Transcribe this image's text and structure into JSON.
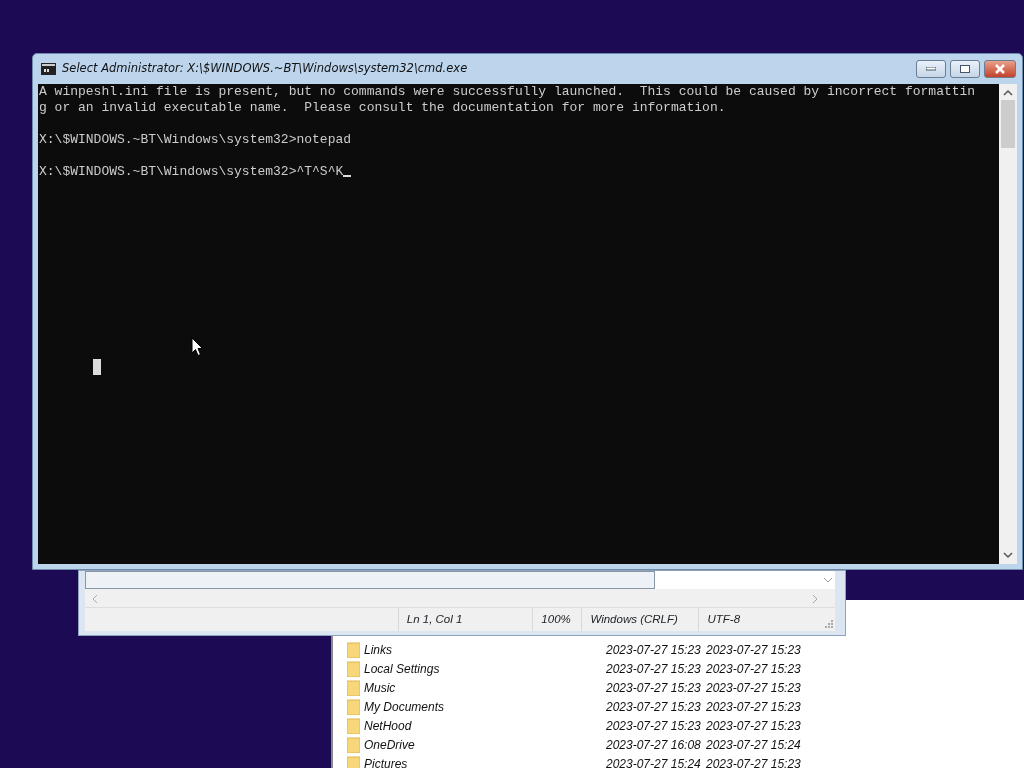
{
  "console_window": {
    "title": "Select Administrator: X:\\$WINDOWS.~BT\\Windows\\system32\\cmd.exe",
    "groups": [
      [
        "A winpeshl.ini file is present, but no commands were successfully launched.  This could be caused by incorrect formattin",
        "g or an invalid executable name.  Please consult the documentation for more information."
      ],
      [
        "X:\\$WINDOWS.~BT\\Windows\\system32>notepad"
      ],
      [
        "X:\\$WINDOWS.~BT\\Windows\\system32>^T^S^K"
      ]
    ]
  },
  "notepad_window": {
    "status_bar": [
      "Ln 1, Col 1",
      "100%",
      "Windows (CRLF)",
      "UTF-8"
    ]
  },
  "explorer_window": {
    "rows": [
      {
        "name": "Links",
        "date_1": "2023-07-27 15:23",
        "date_2": "2023-07-27 15:23"
      },
      {
        "name": "Local Settings",
        "date_1": "2023-07-27 15:23",
        "date_2": "2023-07-27 15:23"
      },
      {
        "name": "Music",
        "date_1": "2023-07-27 15:23",
        "date_2": "2023-07-27 15:23"
      },
      {
        "name": "My Documents",
        "date_1": "2023-07-27 15:23",
        "date_2": "2023-07-27 15:23"
      },
      {
        "name": "NetHood",
        "date_1": "2023-07-27 15:23",
        "date_2": "2023-07-27 15:23"
      },
      {
        "name": "OneDrive",
        "date_1": "2023-07-27 16:08",
        "date_2": "2023-07-27 15:24"
      },
      {
        "name": "Pictures",
        "date_1": "2023-07-27 15:24",
        "date_2": "2023-07-27 15:23"
      }
    ]
  }
}
